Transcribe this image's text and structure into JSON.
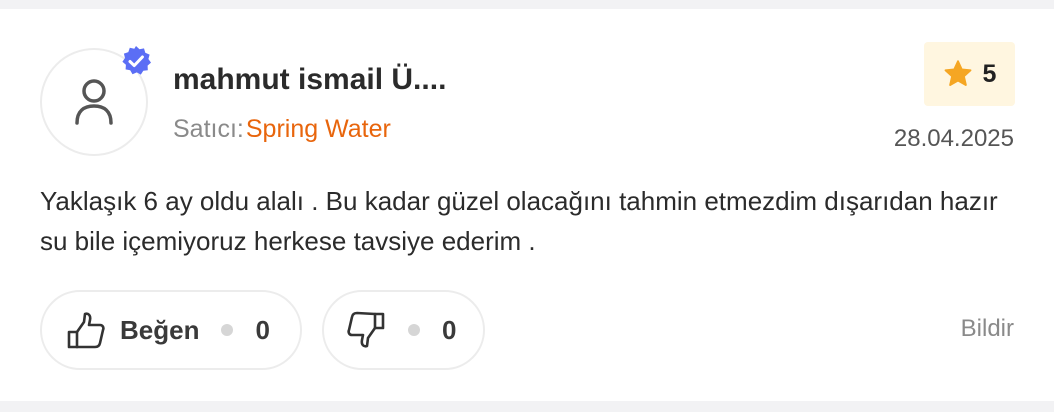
{
  "review": {
    "username": "mahmut ismail Ü....",
    "seller_label": "Satıcı:",
    "seller_name": "Spring Water",
    "rating": "5",
    "date": "28.04.2025",
    "text": "Yaklaşık 6 ay oldu alalı . Bu kadar güzel olacağını tahmin etmezdim dışarıdan hazır su bile içemiyoruz herkese tavsiye ederim ."
  },
  "actions": {
    "like_label": "Beğen",
    "like_count": "0",
    "dislike_count": "0",
    "report_label": "Bildir"
  },
  "colors": {
    "accent": "#e8650c",
    "verified": "#5b6ef5",
    "star": "#f5a623",
    "rating_bg": "#fff6e0"
  }
}
